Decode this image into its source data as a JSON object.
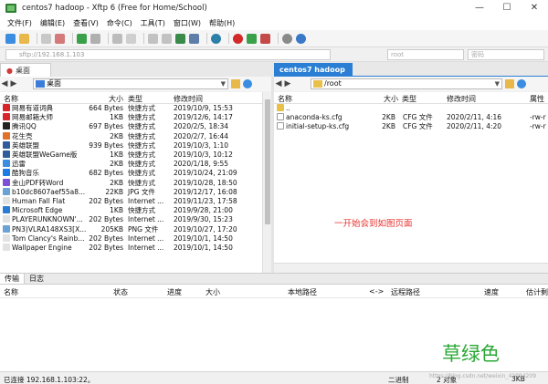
{
  "window": {
    "title": "centos7 hadoop - Xftp 6 (Free for Home/School)",
    "minimize": "—",
    "maximize": "☐",
    "close": "✕"
  },
  "menu": [
    "文件(F)",
    "编辑(E)",
    "查看(V)",
    "命令(C)",
    "工具(T)",
    "窗口(W)",
    "帮助(H)"
  ],
  "address": {
    "host": "sftp://192.168.1.103",
    "user_placeholder": "root",
    "password_placeholder": "密码"
  },
  "left_pane": {
    "tab": "桌面",
    "path": "桌面",
    "columns": {
      "name": "名称",
      "size": "大小",
      "type": "类型",
      "modified": "修改时间"
    },
    "files": [
      {
        "name": "网易有道词典",
        "size": "664 Bytes",
        "type": "快捷方式",
        "modified": "2019/10/9, 15:53",
        "icon_color": "#d8242b"
      },
      {
        "name": "网易邮箱大师",
        "size": "1KB",
        "type": "快捷方式",
        "modified": "2019/12/6, 14:17",
        "icon_color": "#d8242b"
      },
      {
        "name": "腾讯QQ",
        "size": "697 Bytes",
        "type": "快捷方式",
        "modified": "2020/2/5, 18:34",
        "icon_color": "#222222"
      },
      {
        "name": "花生壳",
        "size": "2KB",
        "type": "快捷方式",
        "modified": "2020/2/7, 16:44",
        "icon_color": "#e0702a"
      },
      {
        "name": "英雄联盟",
        "size": "939 Bytes",
        "type": "快捷方式",
        "modified": "2019/10/3, 1:10",
        "icon_color": "#2f5c9a"
      },
      {
        "name": "英雄联盟WeGame版",
        "size": "1KB",
        "type": "快捷方式",
        "modified": "2019/10/3, 10:12",
        "icon_color": "#2f5c9a"
      },
      {
        "name": "迅雷",
        "size": "2KB",
        "type": "快捷方式",
        "modified": "2020/1/18, 9:55",
        "icon_color": "#3a8de0"
      },
      {
        "name": "酷狗音乐",
        "size": "682 Bytes",
        "type": "快捷方式",
        "modified": "2019/10/24, 21:09",
        "icon_color": "#1e7be5"
      },
      {
        "name": "金山PDF转Word",
        "size": "2KB",
        "type": "快捷方式",
        "modified": "2019/10/28, 18:50",
        "icon_color": "#7b4fd6"
      },
      {
        "name": "b10dc8607aef55a8...",
        "size": "22KB",
        "type": "JPG 文件",
        "modified": "2019/12/17, 16:08",
        "icon_color": "#6aa2d6"
      },
      {
        "name": "Human Fall Flat",
        "size": "202 Bytes",
        "type": "Internet ...",
        "modified": "2019/11/23, 17:58",
        "icon_color": "#e2e2e2"
      },
      {
        "name": "Microsoft Edge",
        "size": "1KB",
        "type": "快捷方式",
        "modified": "2019/9/28, 21:00",
        "icon_color": "#2b7cd3"
      },
      {
        "name": "PLAYERUNKNOWN'...",
        "size": "202 Bytes",
        "type": "Internet ...",
        "modified": "2019/9/30, 15:23",
        "icon_color": "#e2e2e2"
      },
      {
        "name": "PN3)VLRA148XS3[X...",
        "size": "205KB",
        "type": "PNG 文件",
        "modified": "2019/10/27, 17:20",
        "icon_color": "#6aa2d6"
      },
      {
        "name": "Tom Clancy's Rainb...",
        "size": "202 Bytes",
        "type": "Internet ...",
        "modified": "2019/10/1, 14:50",
        "icon_color": "#e2e2e2"
      },
      {
        "name": "Wallpaper Engine",
        "size": "202 Bytes",
        "type": "Internet ...",
        "modified": "2019/10/1, 14:50",
        "icon_color": "#e2e2e2"
      }
    ],
    "scroll_position": 0.0,
    "scroll_visible_fraction": 0.75
  },
  "right_pane": {
    "tab": "centos7 hadoop",
    "path": "/root",
    "columns": {
      "name": "名称",
      "size": "大小",
      "type": "类型",
      "modified": "修改时间",
      "attr": "属性"
    },
    "files": [
      {
        "name": "..",
        "size": "",
        "type": "",
        "modified": "",
        "attr": "",
        "icon_color": "#e8c04a"
      },
      {
        "name": "anaconda-ks.cfg",
        "size": "2KB",
        "type": "CFG 文件",
        "modified": "2020/2/11, 4:16",
        "attr": "-rw-r",
        "icon_color": "#ffffff"
      },
      {
        "name": "initial-setup-ks.cfg",
        "size": "2KB",
        "type": "CFG 文件",
        "modified": "2020/2/11, 4:20",
        "attr": "-rw-r",
        "icon_color": "#ffffff"
      }
    ]
  },
  "annotation": "一开始会到如图页面",
  "transfer": {
    "tabs": [
      "传输",
      "日志"
    ],
    "columns": [
      "名称",
      "状态",
      "进度",
      "大小",
      "本地路径",
      "<->",
      "远程路径",
      "速度",
      "估计剩"
    ]
  },
  "watermark": "草绿色",
  "status": {
    "connection": "已连接 192.168.1.103:22。",
    "mode": "二进制",
    "objects": "2 对象",
    "size": "3KB"
  },
  "csdn_credit": "https://blog.csdn.net/weixin_42094209"
}
